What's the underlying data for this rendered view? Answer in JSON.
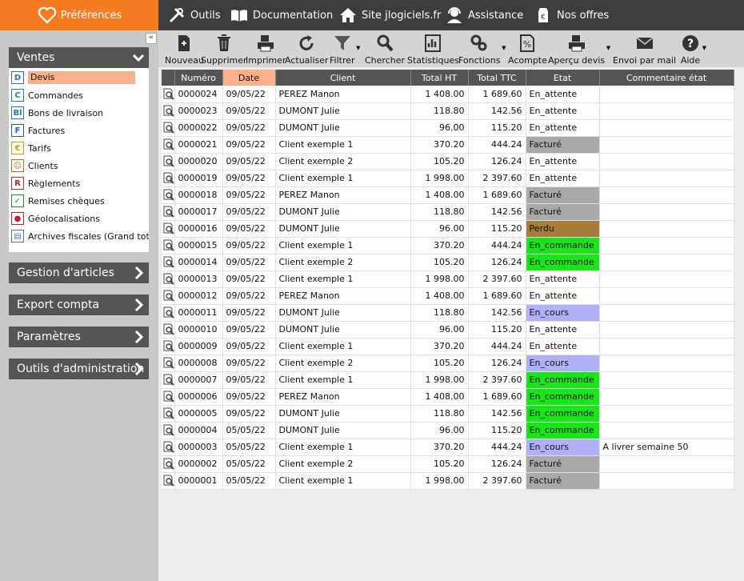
{
  "topbar": {
    "preferences": "Préférences",
    "nav": [
      {
        "label": "Outils",
        "icon": "tools-icon"
      },
      {
        "label": "Documentation",
        "icon": "book-icon"
      },
      {
        "label": "Site jlogiciels.fr",
        "icon": "home-icon"
      },
      {
        "label": "Assistance",
        "icon": "headset-icon"
      },
      {
        "label": "Nos offres",
        "icon": "price-tag-icon"
      }
    ]
  },
  "sidebar": {
    "collapse_glyph": "«",
    "ventes": {
      "title": "Ventes",
      "items": [
        {
          "label": "Devis",
          "glyph": "D",
          "color": "#2f6fbf"
        },
        {
          "label": "Commandes",
          "glyph": "C",
          "color": "#1e8a8a"
        },
        {
          "label": "Bons de livraison",
          "glyph": "Bl",
          "color": "#1e7ab8"
        },
        {
          "label": "Factures",
          "glyph": "F",
          "color": "#1f5fbf"
        },
        {
          "label": "Tarifs",
          "glyph": "€",
          "color": "#d49a00"
        },
        {
          "label": "Clients",
          "glyph": "☺",
          "color": "#c06a1a"
        },
        {
          "label": "Règlements",
          "glyph": "R",
          "color": "#c0282a"
        },
        {
          "label": "Remises chèques",
          "glyph": "✓",
          "color": "#2a8a2a"
        },
        {
          "label": "Géolocalisations",
          "glyph": "●",
          "color": "#b8252a"
        },
        {
          "label": "Archives fiscales (Grand totaux)",
          "glyph": "▤",
          "color": "#4a7ab8"
        }
      ]
    },
    "sections": [
      "Gestion d'articles",
      "Export compta",
      "Paramètres",
      "Outils d'administration"
    ]
  },
  "toolbar": [
    {
      "label": "Nouveau",
      "icon": "new-document-icon"
    },
    {
      "label": "Supprimer",
      "icon": "trash-icon"
    },
    {
      "label": "Imprimer",
      "icon": "printer-icon"
    },
    {
      "label": "Actualiser",
      "icon": "refresh-icon"
    },
    {
      "label": "Filtrer",
      "icon": "filter-icon",
      "dropdown": true
    },
    {
      "label": "Chercher",
      "icon": "magnifier-icon"
    },
    {
      "label": "Statistiques",
      "icon": "statistics-icon"
    },
    {
      "label": "Fonctions",
      "icon": "gears-icon",
      "dropdown": true
    },
    {
      "label": "Acompte",
      "icon": "percent-icon"
    },
    {
      "label": "Aperçu devis",
      "icon": "print-preview-icon",
      "dropdown": true
    },
    {
      "label": "Envoi par mail",
      "icon": "envelope-icon"
    },
    {
      "label": "Aide",
      "icon": "help-icon",
      "dropdown": true
    }
  ],
  "table": {
    "columns": [
      "",
      "Numéro",
      "Date",
      "Client",
      "Total HT",
      "Total TTC",
      "Etat",
      "Commentaire état"
    ],
    "sorted_column": "Date",
    "status_colors": {
      "En_attente": "#ffffff",
      "Facturé": "#a9a9a9",
      "Perdu": "#a67c3a",
      "En_commande": "#19e619",
      "En_cours": "#b0b0f8"
    },
    "rows": [
      {
        "num": "0000024",
        "date": "09/05/22",
        "client": "PEREZ Manon",
        "ht": "1 408.00",
        "ttc": "1 689.60",
        "etat": "En_attente",
        "comment": ""
      },
      {
        "num": "0000023",
        "date": "09/05/22",
        "client": "DUMONT Julie",
        "ht": "118.80",
        "ttc": "142.56",
        "etat": "En_attente",
        "comment": ""
      },
      {
        "num": "0000022",
        "date": "09/05/22",
        "client": "DUMONT Julie",
        "ht": "96.00",
        "ttc": "115.20",
        "etat": "En_attente",
        "comment": ""
      },
      {
        "num": "0000021",
        "date": "09/05/22",
        "client": "Client exemple 1",
        "ht": "370.20",
        "ttc": "444.24",
        "etat": "Facturé",
        "comment": ""
      },
      {
        "num": "0000020",
        "date": "09/05/22",
        "client": "Client exemple 2",
        "ht": "105.20",
        "ttc": "126.24",
        "etat": "En_attente",
        "comment": ""
      },
      {
        "num": "0000019",
        "date": "09/05/22",
        "client": "Client exemple 1",
        "ht": "1 998.00",
        "ttc": "2 397.60",
        "etat": "En_attente",
        "comment": ""
      },
      {
        "num": "0000018",
        "date": "09/05/22",
        "client": "PEREZ Manon",
        "ht": "1 408.00",
        "ttc": "1 689.60",
        "etat": "Facturé",
        "comment": ""
      },
      {
        "num": "0000017",
        "date": "09/05/22",
        "client": "DUMONT Julie",
        "ht": "118.80",
        "ttc": "142.56",
        "etat": "Facturé",
        "comment": ""
      },
      {
        "num": "0000016",
        "date": "09/05/22",
        "client": "DUMONT Julie",
        "ht": "96.00",
        "ttc": "115.20",
        "etat": "Perdu",
        "comment": ""
      },
      {
        "num": "0000015",
        "date": "09/05/22",
        "client": "Client exemple 1",
        "ht": "370.20",
        "ttc": "444.24",
        "etat": "En_commande",
        "comment": ""
      },
      {
        "num": "0000014",
        "date": "09/05/22",
        "client": "Client exemple 2",
        "ht": "105.20",
        "ttc": "126.24",
        "etat": "En_commande",
        "comment": ""
      },
      {
        "num": "0000013",
        "date": "09/05/22",
        "client": "Client exemple 1",
        "ht": "1 998.00",
        "ttc": "2 397.60",
        "etat": "En_attente",
        "comment": ""
      },
      {
        "num": "0000012",
        "date": "09/05/22",
        "client": "PEREZ Manon",
        "ht": "1 408.00",
        "ttc": "1 689.60",
        "etat": "En_attente",
        "comment": ""
      },
      {
        "num": "0000011",
        "date": "09/05/22",
        "client": "DUMONT Julie",
        "ht": "118.80",
        "ttc": "142.56",
        "etat": "En_cours",
        "comment": ""
      },
      {
        "num": "0000010",
        "date": "09/05/22",
        "client": "DUMONT Julie",
        "ht": "96.00",
        "ttc": "115.20",
        "etat": "En_attente",
        "comment": ""
      },
      {
        "num": "0000009",
        "date": "09/05/22",
        "client": "Client exemple 1",
        "ht": "370.20",
        "ttc": "444.24",
        "etat": "En_attente",
        "comment": ""
      },
      {
        "num": "0000008",
        "date": "09/05/22",
        "client": "Client exemple 2",
        "ht": "105.20",
        "ttc": "126.24",
        "etat": "En_cours",
        "comment": ""
      },
      {
        "num": "0000007",
        "date": "09/05/22",
        "client": "Client exemple 1",
        "ht": "1 998.00",
        "ttc": "2 397.60",
        "etat": "En_commande",
        "comment": ""
      },
      {
        "num": "0000006",
        "date": "09/05/22",
        "client": "PEREZ Manon",
        "ht": "1 408.00",
        "ttc": "1 689.60",
        "etat": "En_commande",
        "comment": ""
      },
      {
        "num": "0000005",
        "date": "09/05/22",
        "client": "DUMONT Julie",
        "ht": "118.80",
        "ttc": "142.56",
        "etat": "En_commande",
        "comment": ""
      },
      {
        "num": "0000004",
        "date": "05/05/22",
        "client": "DUMONT Julie",
        "ht": "96.00",
        "ttc": "115.20",
        "etat": "En_commande",
        "comment": ""
      },
      {
        "num": "0000003",
        "date": "05/05/22",
        "client": "Client exemple 1",
        "ht": "370.20",
        "ttc": "444.24",
        "etat": "En_cours",
        "comment": "A livrer semaine 50"
      },
      {
        "num": "0000002",
        "date": "05/05/22",
        "client": "Client exemple 2",
        "ht": "105.20",
        "ttc": "126.24",
        "etat": "Facturé",
        "comment": ""
      },
      {
        "num": "0000001",
        "date": "05/05/22",
        "client": "Client exemple 1",
        "ht": "1 998.00",
        "ttc": "2 397.60",
        "etat": "Facturé",
        "comment": ""
      }
    ]
  }
}
